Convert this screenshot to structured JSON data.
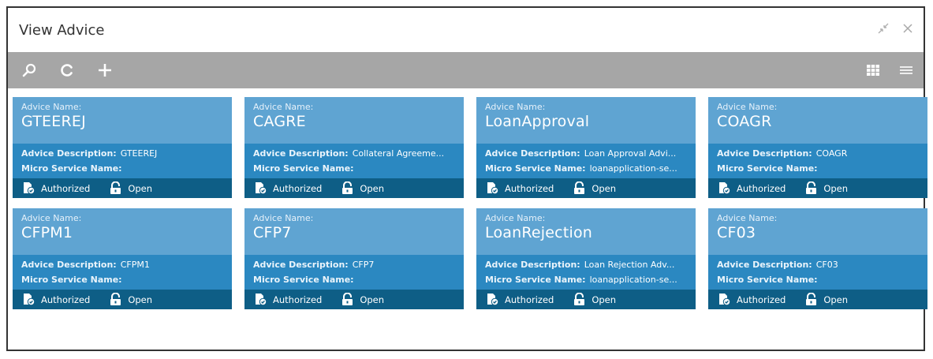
{
  "window": {
    "title": "View Advice"
  },
  "icons": {
    "minimize": "minimize-arrows-icon",
    "close": "close-icon",
    "search": "search-icon",
    "refresh": "refresh-icon",
    "add": "plus-icon",
    "tiles": "grid-view-icon",
    "list": "list-view-icon"
  },
  "labels": {
    "advice_name": "Advice Name:",
    "advice_description": "Advice Description:",
    "micro_service_name": "Micro Service Name:",
    "authorized": "Authorized",
    "open": "Open"
  },
  "colors": {
    "toolbar": "#a6a6a6",
    "card_top": "#5fa4d2",
    "card_mid": "#2b88c1",
    "card_bottom": "#0e5e86"
  },
  "cards": [
    {
      "name": "GTEEREJ",
      "description": "GTEEREJ",
      "micro_service": ""
    },
    {
      "name": "CAGRE",
      "description": "Collateral Agreeme...",
      "micro_service": ""
    },
    {
      "name": "LoanApproval",
      "description": "Loan Approval Advi...",
      "micro_service": "loanapplication-se..."
    },
    {
      "name": "COAGR",
      "description": "COAGR",
      "micro_service": ""
    },
    {
      "name": "CFPM1",
      "description": "CFPM1",
      "micro_service": ""
    },
    {
      "name": "CFP7",
      "description": "CFP7",
      "micro_service": ""
    },
    {
      "name": "LoanRejection",
      "description": "Loan Rejection Adv...",
      "micro_service": "loanapplication-se..."
    },
    {
      "name": "CF03",
      "description": "CF03",
      "micro_service": ""
    }
  ]
}
